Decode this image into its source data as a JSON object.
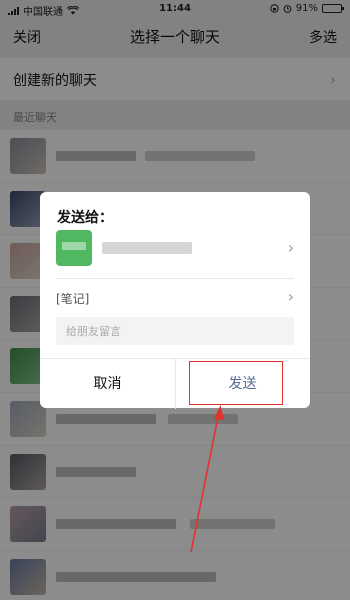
{
  "status_bar": {
    "carrier": "中国联通",
    "time": "11:44",
    "battery": "91%",
    "battery_level": 0.91
  },
  "nav": {
    "close": "关闭",
    "title": "选择一个聊天",
    "multi_select": "多选"
  },
  "create_chat": {
    "label": "创建新的聊天",
    "chevron": "›"
  },
  "section_header": "最近聊天",
  "dialog": {
    "title": "发送给：",
    "chevron": "›",
    "note_label": "[笔记]",
    "message_placeholder": "给朋友留言",
    "cancel": "取消",
    "send": "发送"
  },
  "colors": {
    "accent_link": "#576b95",
    "highlight_red": "#e3312c",
    "avatar_green": "#4fb861"
  }
}
